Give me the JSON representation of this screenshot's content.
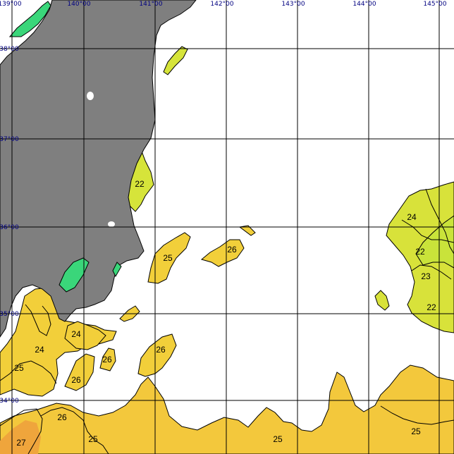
{
  "map": {
    "colors": {
      "water": "#ffffff",
      "land": "#7f7f7f",
      "grid": "#000000",
      "axis_label": "#000080",
      "sst_22": "#d6e43a",
      "sst_24_26": "#f2d03a",
      "sst_25": "#f5c63a",
      "sst_27": "#f0a83a",
      "sst_cold": "#3ad67a"
    },
    "longitude_labels": [
      "139°00",
      "140°00",
      "141°00",
      "142°00",
      "143°00",
      "144°00",
      "145°00"
    ],
    "latitude_labels": [
      "38°00",
      "37°00",
      "36°00",
      "35°00",
      "34°00"
    ],
    "contour_labels": [
      "22",
      "25",
      "26",
      "24",
      "22",
      "23",
      "22",
      "24",
      "25",
      "26",
      "26",
      "24",
      "26",
      "26",
      "27",
      "25",
      "25",
      "25"
    ]
  }
}
